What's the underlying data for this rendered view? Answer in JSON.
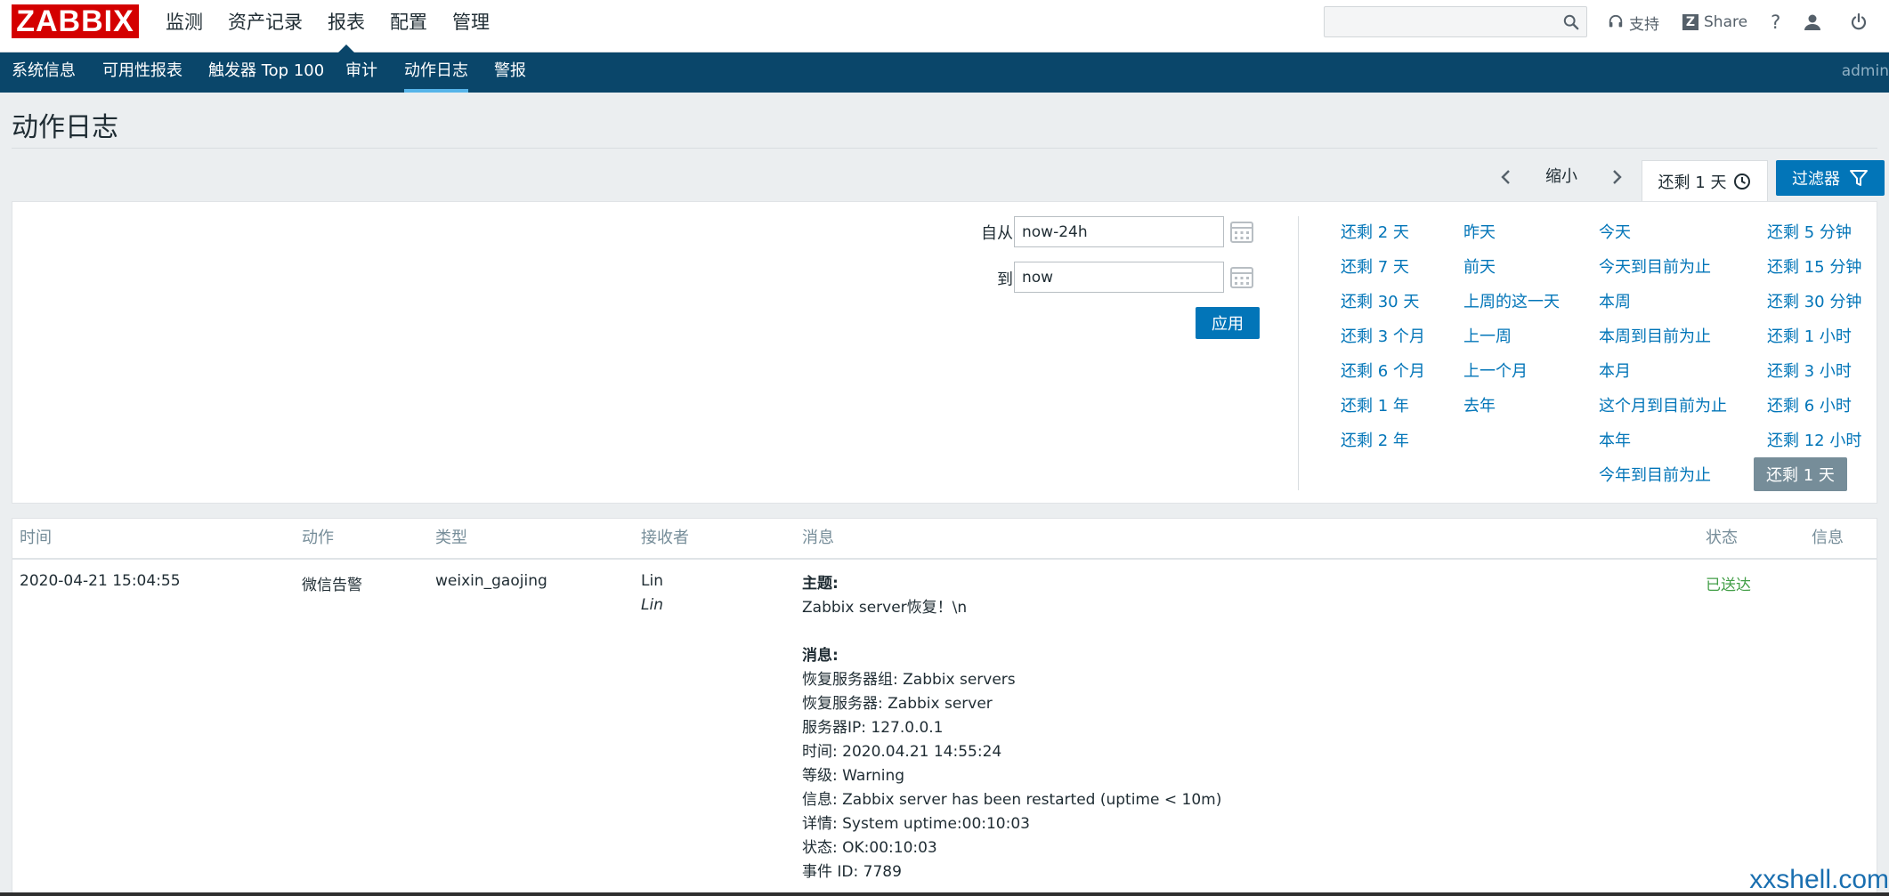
{
  "header": {
    "logo": "ZABBIX",
    "menu": [
      "监测",
      "资产记录",
      "报表",
      "配置",
      "管理"
    ],
    "active_menu": "报表",
    "search_placeholder": "",
    "support_label": "支持",
    "share_label": "Share",
    "help_label": "?"
  },
  "subnav": {
    "items": [
      "系统信息",
      "可用性报表",
      "触发器 Top 100",
      "审计",
      "动作日志",
      "警报"
    ],
    "active": "动作日志",
    "user": "admin"
  },
  "page": {
    "title": "动作日志"
  },
  "time_controls": {
    "zoom_out": "缩小",
    "time_tab": "还剩 1 天",
    "filter_tab": "过滤器"
  },
  "filter": {
    "from_label": "自从",
    "from_value": "now-24h",
    "to_label": "到",
    "to_value": "now",
    "apply": "应用",
    "quick_ranges": {
      "col1": [
        "还剩 2 天",
        "还剩 7 天",
        "还剩 30 天",
        "还剩 3 个月",
        "还剩 6 个月",
        "还剩 1 年",
        "还剩 2 年"
      ],
      "col2": [
        "昨天",
        "前天",
        "上周的这一天",
        "上一周",
        "上一个月",
        "去年"
      ],
      "col3": [
        "今天",
        "今天到目前为止",
        "本周",
        "本周到目前为止",
        "本月",
        "这个月到目前为止",
        "本年",
        "今年到目前为止"
      ],
      "col4": [
        "还剩 5 分钟",
        "还剩 15 分钟",
        "还剩 30 分钟",
        "还剩 1 小时",
        "还剩 3 小时",
        "还剩 6 小时",
        "还剩 12 小时",
        "还剩 1 天"
      ],
      "selected": "还剩 1 天"
    }
  },
  "table": {
    "headers": [
      "时间",
      "动作",
      "类型",
      "接收者",
      "消息",
      "状态",
      "信息"
    ],
    "rows": [
      {
        "time": "2020-04-21 15:04:55",
        "action": "微信告警",
        "type": "weixin_gaojing",
        "recipient": "Lin",
        "recipient_alias": "Lin",
        "subject_label": "主题:",
        "subject": "Zabbix server恢复！\\n",
        "message_label": "消息:",
        "message_lines": [
          "恢复服务器组: Zabbix servers",
          "恢复服务器: Zabbix server",
          "服务器IP: 127.0.0.1",
          "时间: 2020.04.21 14:55:24",
          "等级: Warning",
          "信息: Zabbix server has been restarted (uptime < 10m)",
          "详情: System uptime:00:10:03",
          "状态: OK:00:10:03",
          "事件 ID: 7789"
        ],
        "status": "已送达",
        "info": ""
      }
    ]
  },
  "watermark": "xxshell.com",
  "colors": {
    "brand_red": "#d40000",
    "nav_blue": "#0a466a",
    "accent_blue": "#0275b8",
    "status_ok": "#429e47",
    "selected_grey": "#768d99"
  }
}
